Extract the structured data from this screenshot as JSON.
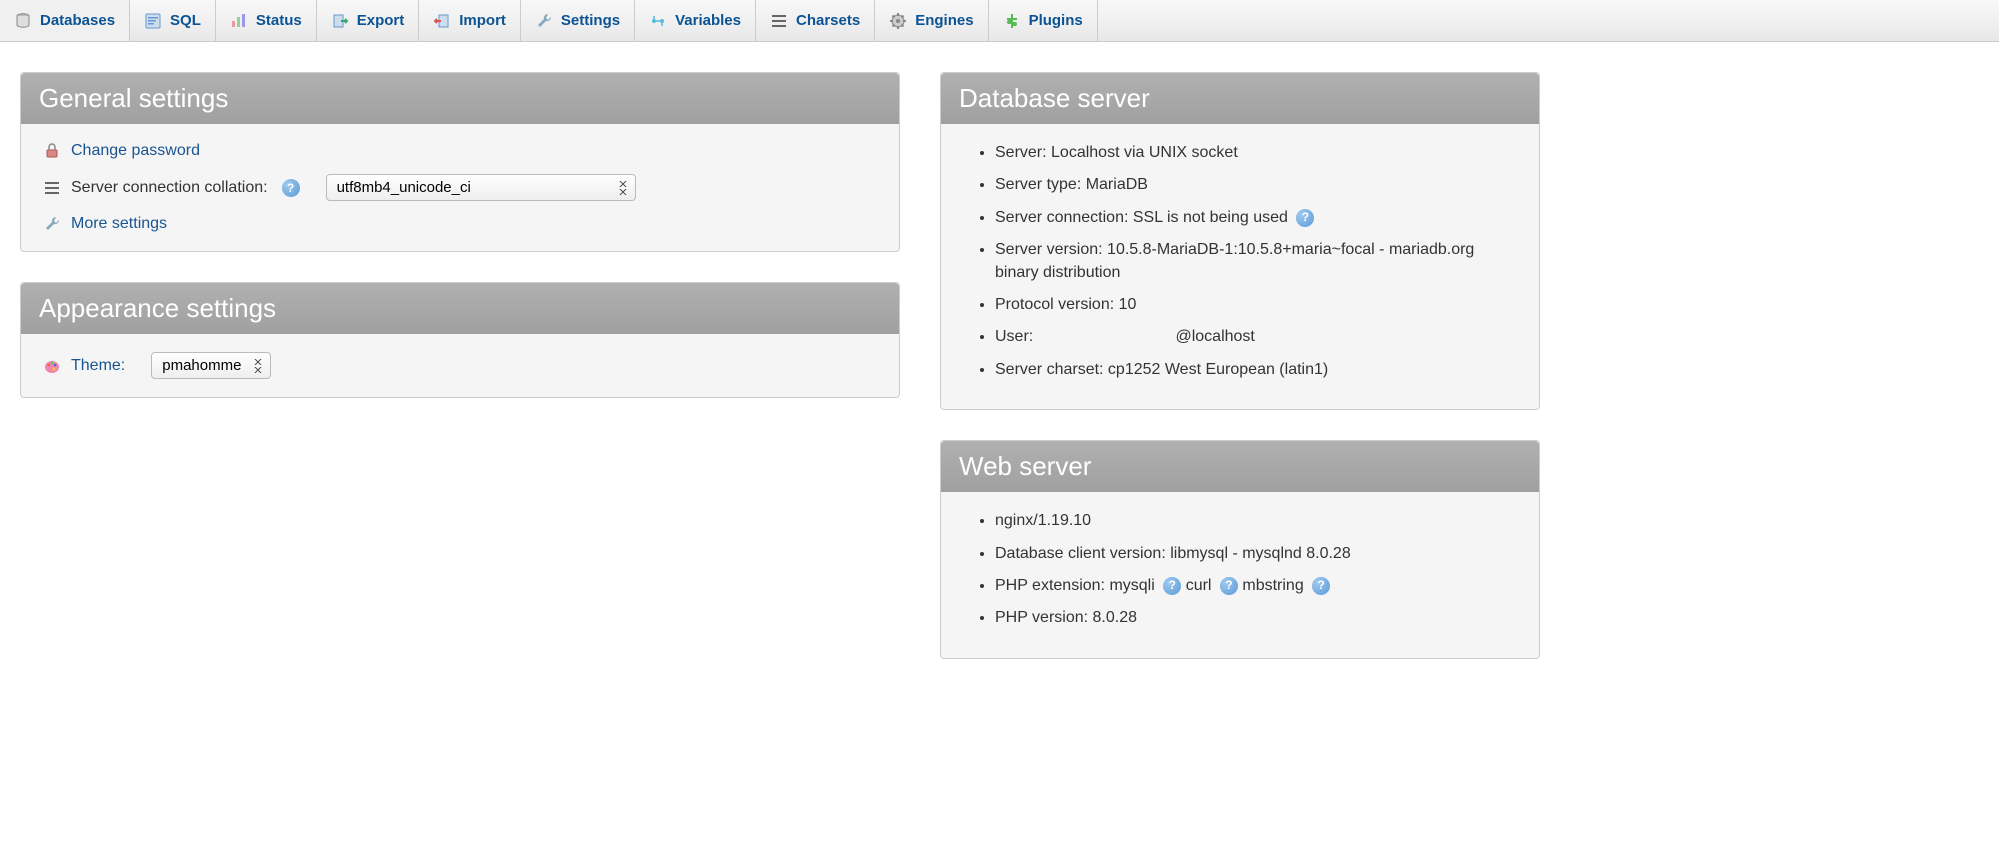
{
  "topnav": [
    {
      "label": "Databases",
      "icon": "database-icon"
    },
    {
      "label": "SQL",
      "icon": "sql-icon"
    },
    {
      "label": "Status",
      "icon": "status-icon"
    },
    {
      "label": "Export",
      "icon": "export-icon"
    },
    {
      "label": "Import",
      "icon": "import-icon"
    },
    {
      "label": "Settings",
      "icon": "settings-icon"
    },
    {
      "label": "Variables",
      "icon": "variables-icon"
    },
    {
      "label": "Charsets",
      "icon": "charsets-icon"
    },
    {
      "label": "Engines",
      "icon": "engines-icon"
    },
    {
      "label": "Plugins",
      "icon": "plugins-icon"
    }
  ],
  "general": {
    "title": "General settings",
    "change_password": "Change password",
    "collation_label": "Server connection collation:",
    "collation_value": "utf8mb4_unicode_ci",
    "more_settings": "More settings"
  },
  "appearance": {
    "title": "Appearance settings",
    "theme_label": "Theme:",
    "theme_value": "pmahomme"
  },
  "db_server": {
    "title": "Database server",
    "items": [
      "Server: Localhost via UNIX socket",
      "Server type: MariaDB",
      "Server connection: SSL is not being used",
      "Server version: 10.5.8-MariaDB-1:10.5.8+maria~focal - mariadb.org binary distribution",
      "Protocol version: 10",
      "User:                                @localhost",
      "Server charset: cp1252 West European (latin1)"
    ],
    "ssl_help_index": 2
  },
  "web_server": {
    "title": "Web server",
    "nginx": "nginx/1.19.10",
    "db_client": "Database client version: libmysql - mysqlnd 8.0.28",
    "php_ext_label": "PHP extension:",
    "php_exts": [
      "mysqli",
      "curl",
      "mbstring"
    ],
    "php_version": "PHP version: 8.0.28"
  }
}
